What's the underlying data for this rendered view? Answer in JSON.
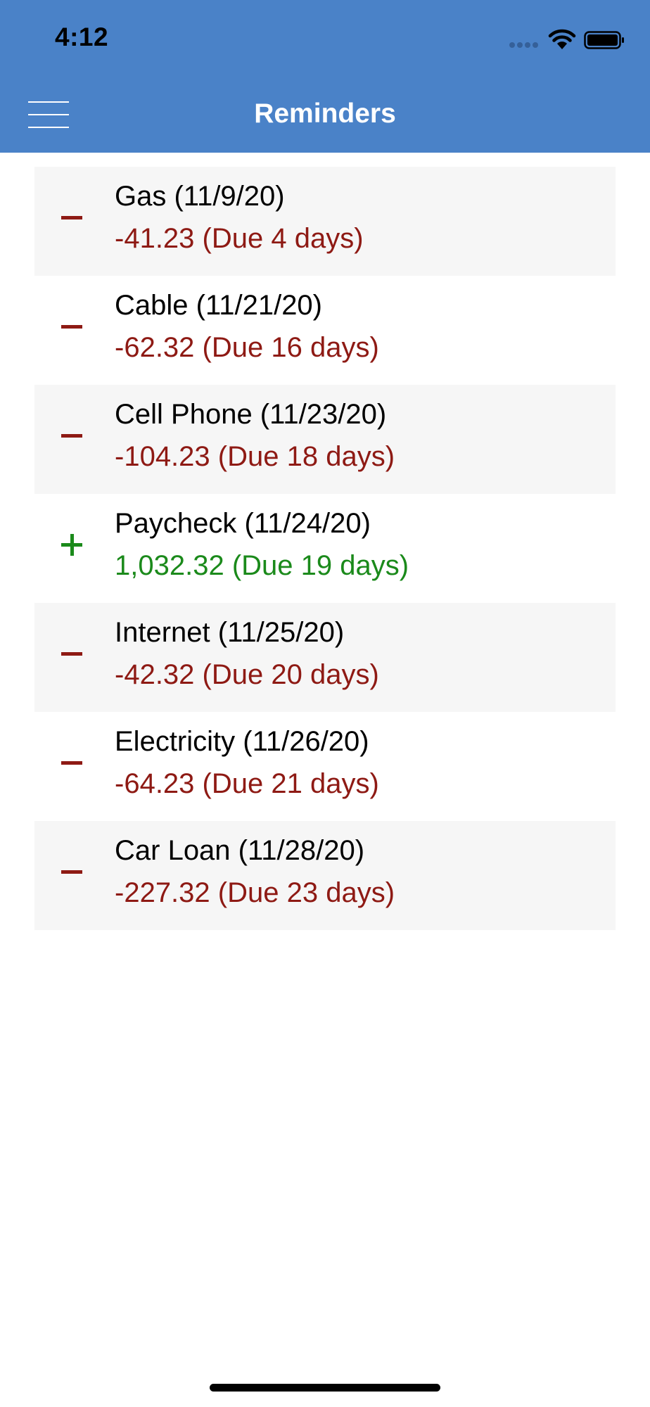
{
  "status_bar": {
    "time": "4:12"
  },
  "header": {
    "title": "Reminders",
    "menu_icon": "hamburger-menu-icon",
    "background": "#4a82c8"
  },
  "colors": {
    "expense": "#8e1a14",
    "income": "#1b8a1b",
    "row_shade": "#f6f6f6"
  },
  "reminders": [
    {
      "title": "Gas (11/9/20)",
      "amount": "-41.23 (Due 4 days)",
      "type": "expense",
      "sign_icon": "minus-icon"
    },
    {
      "title": "Cable (11/21/20)",
      "amount": "-62.32 (Due 16 days)",
      "type": "expense",
      "sign_icon": "minus-icon"
    },
    {
      "title": "Cell Phone (11/23/20)",
      "amount": "-104.23 (Due 18 days)",
      "type": "expense",
      "sign_icon": "minus-icon"
    },
    {
      "title": "Paycheck (11/24/20)",
      "amount": "1,032.32 (Due 19 days)",
      "type": "income",
      "sign_icon": "plus-icon"
    },
    {
      "title": "Internet (11/25/20)",
      "amount": "-42.32 (Due 20 days)",
      "type": "expense",
      "sign_icon": "minus-icon"
    },
    {
      "title": "Electricity (11/26/20)",
      "amount": "-64.23 (Due 21 days)",
      "type": "expense",
      "sign_icon": "minus-icon"
    },
    {
      "title": "Car Loan (11/28/20)",
      "amount": "-227.32 (Due 23 days)",
      "type": "expense",
      "sign_icon": "minus-icon"
    }
  ]
}
